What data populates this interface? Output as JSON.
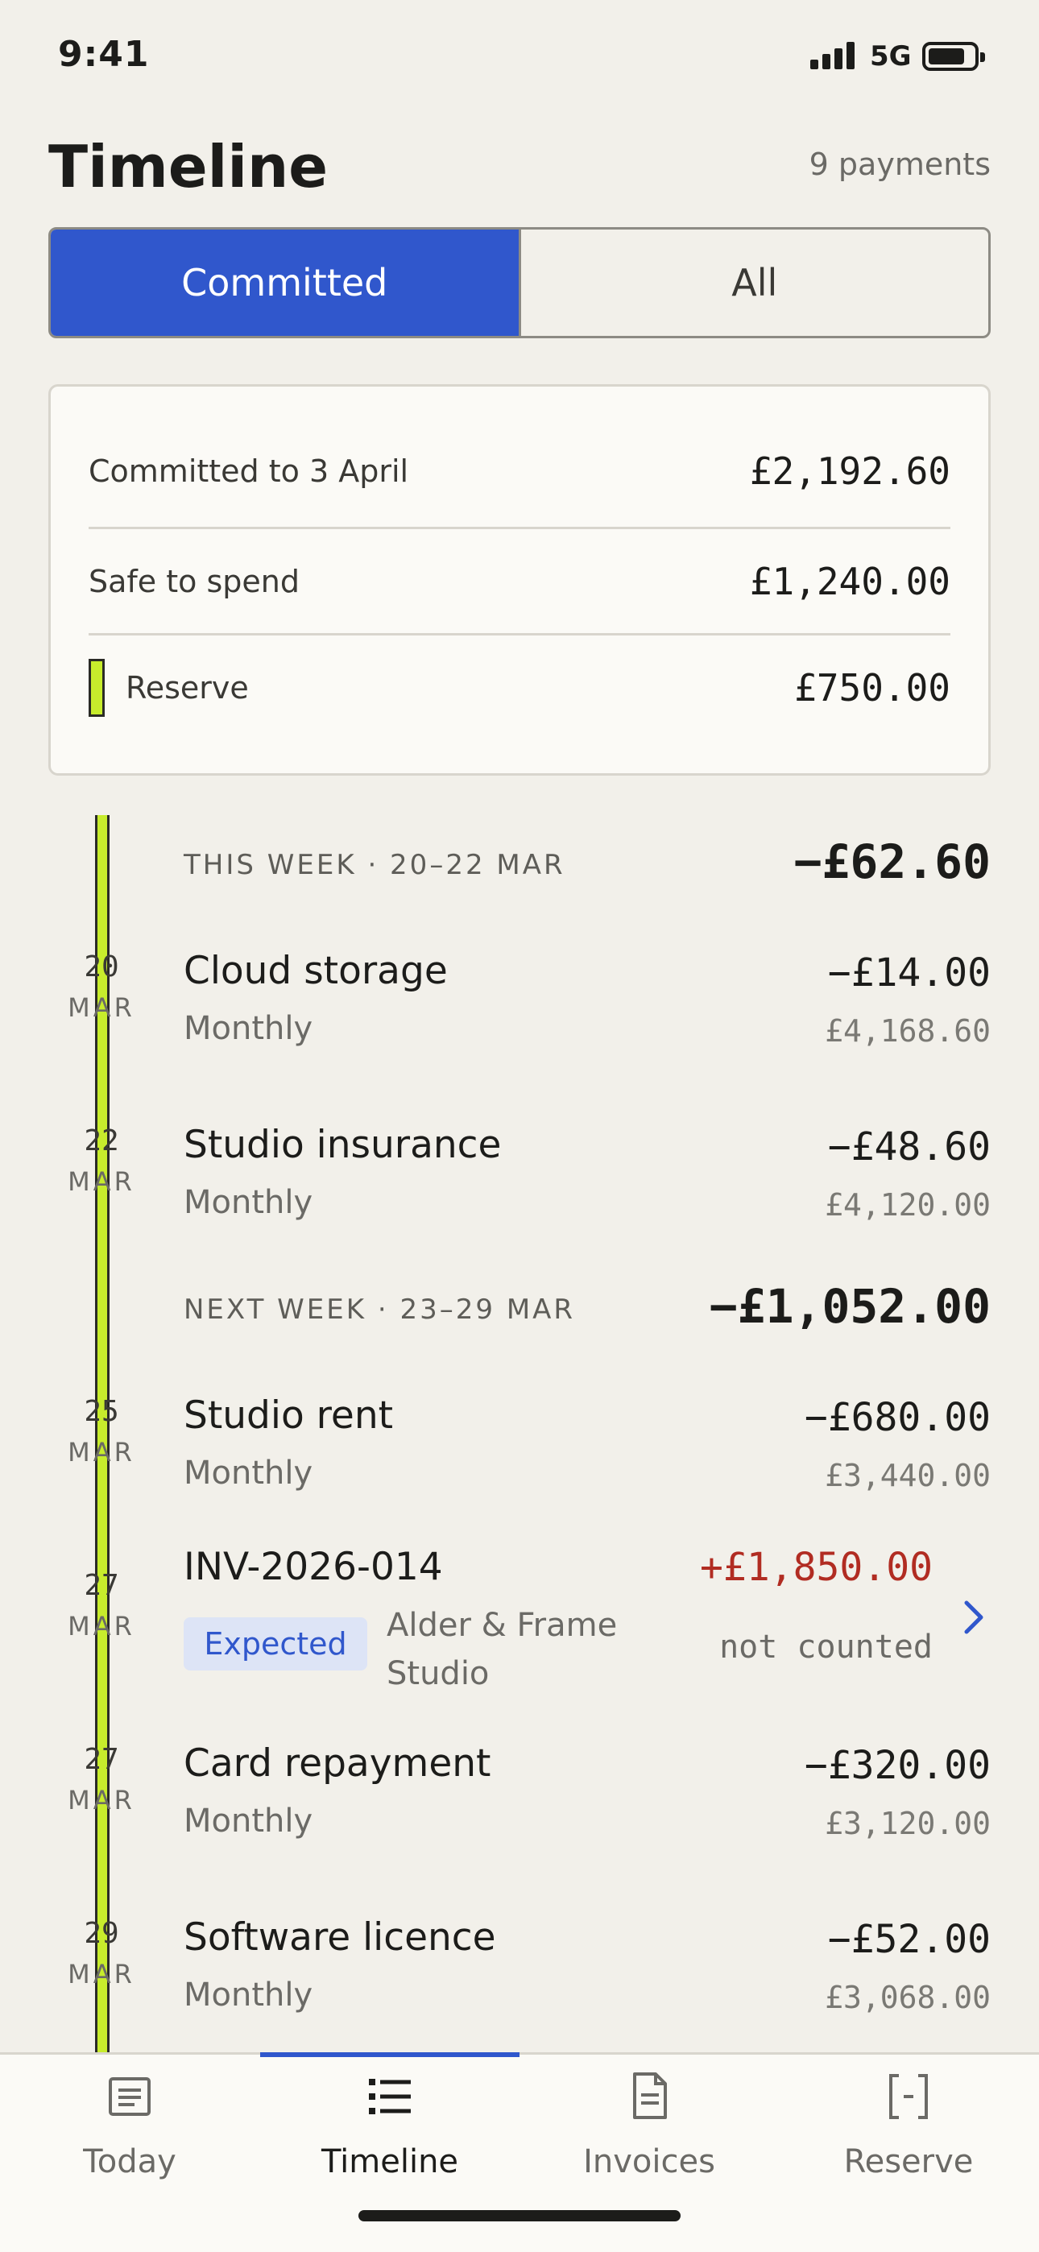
{
  "status": {
    "time": "9:41",
    "network": "5G"
  },
  "header": {
    "title": "Timeline",
    "payments_count": "9 payments"
  },
  "segments": {
    "committed": "Committed",
    "all": "All"
  },
  "summary": {
    "committed_label": "Committed to 3 April",
    "committed_value": "£2,192.60",
    "safe_label": "Safe to spend",
    "safe_value": "£1,240.00",
    "reserve_label": "Reserve",
    "reserve_value": "£750.00",
    "reserve_color": "#c7ec2c"
  },
  "weeks": [
    {
      "label": "THIS WEEK · 20–22 MAR",
      "total": "−£62.60"
    },
    {
      "label": "NEXT WEEK · 23–29 MAR",
      "total": "−£1,052.00"
    }
  ],
  "items": [
    {
      "day": "20",
      "month": "MAR",
      "title": "Cloud storage",
      "sub": "Monthly",
      "amount": "−£14.00",
      "balance": "£4,168.60"
    },
    {
      "day": "22",
      "month": "MAR",
      "title": "Studio insurance",
      "sub": "Monthly",
      "amount": "−£48.60",
      "balance": "£4,120.00"
    },
    {
      "day": "25",
      "month": "MAR",
      "title": "Studio rent",
      "sub": "Monthly",
      "amount": "−£680.00",
      "balance": "£3,440.00"
    },
    {
      "day": "27",
      "month": "MAR",
      "title": "INV-2026-014",
      "badge": "Expected",
      "client": "Alder & Frame Studio",
      "amount": "+£1,850.00",
      "note": "not counted"
    },
    {
      "day": "27",
      "month": "MAR",
      "title": "Card repayment",
      "sub": "Monthly",
      "amount": "−£320.00",
      "balance": "£3,120.00"
    },
    {
      "day": "29",
      "month": "MAR",
      "title": "Software licence",
      "sub": "Monthly",
      "amount": "−£52.00",
      "balance": "£3,068.00"
    }
  ],
  "tabs": [
    {
      "label": "Today",
      "icon": "today-icon"
    },
    {
      "label": "Timeline",
      "icon": "timeline-icon"
    },
    {
      "label": "Invoices",
      "icon": "invoices-icon"
    },
    {
      "label": "Reserve",
      "icon": "reserve-icon"
    }
  ],
  "colors": {
    "accent": "#3057cc",
    "income": "#b12c22",
    "rail": "#c7ec2c"
  }
}
